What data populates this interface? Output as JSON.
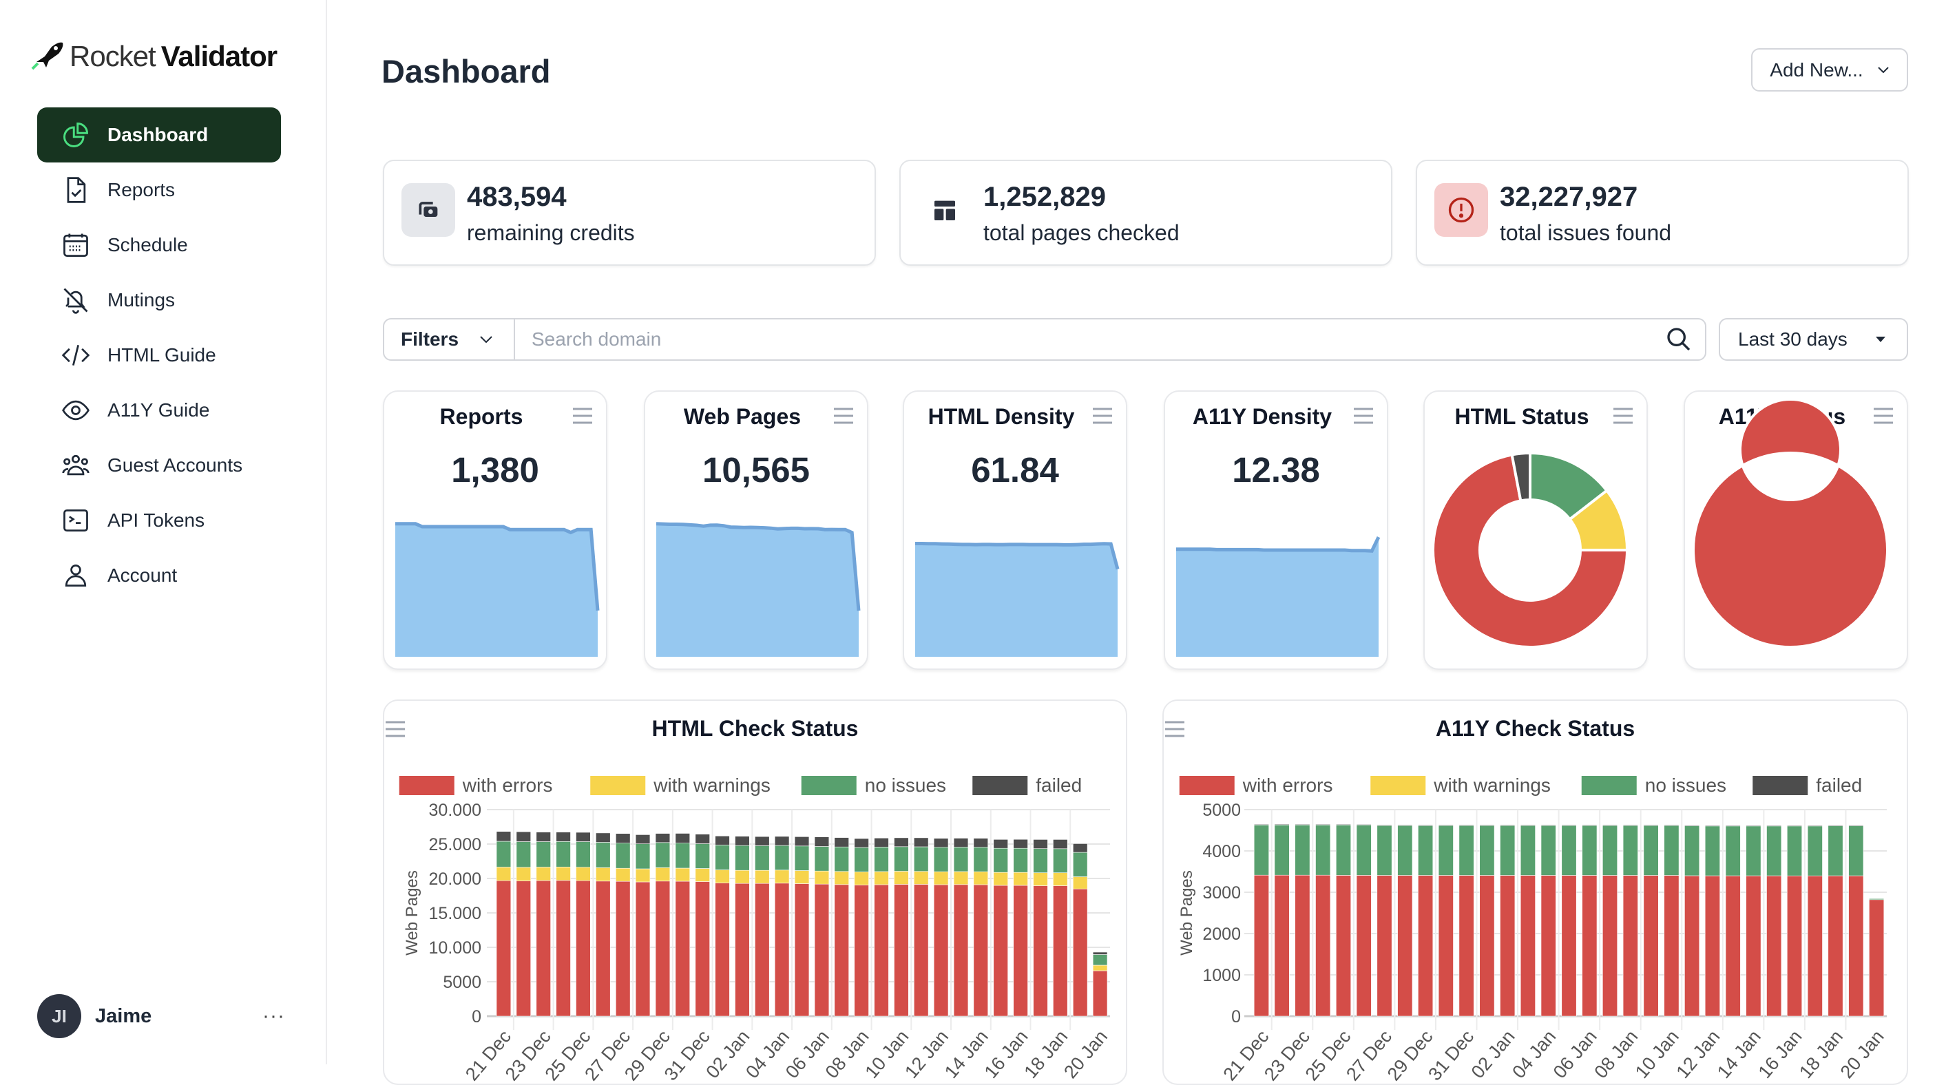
{
  "brand": {
    "name_light": "Rocket",
    "name_bold": "Validator"
  },
  "sidebar": {
    "items": [
      {
        "label": "Dashboard",
        "icon": "chart-pie-icon",
        "active": true
      },
      {
        "label": "Reports",
        "icon": "document-check-icon"
      },
      {
        "label": "Schedule",
        "icon": "calendar-icon"
      },
      {
        "label": "Mutings",
        "icon": "bell-slash-icon"
      },
      {
        "label": "HTML Guide",
        "icon": "code-icon"
      },
      {
        "label": "A11Y Guide",
        "icon": "eye-icon"
      },
      {
        "label": "Guest Accounts",
        "icon": "user-group-icon"
      },
      {
        "label": "API Tokens",
        "icon": "terminal-icon"
      },
      {
        "label": "Account",
        "icon": "user-icon"
      }
    ]
  },
  "user": {
    "initials": "JI",
    "name": "Jaime",
    "menu": "···"
  },
  "header": {
    "title": "Dashboard",
    "add_new": "Add New..."
  },
  "stats": [
    {
      "value": "483,594",
      "label": "remaining credits",
      "icon": "credits-icon"
    },
    {
      "value": "1,252,829",
      "label": "total pages checked",
      "icon": "layout-icon"
    },
    {
      "value": "32,227,927",
      "label": "total issues found",
      "icon": "exclamation-circle-icon"
    }
  ],
  "filters": {
    "label": "Filters",
    "search_placeholder": "Search domain",
    "search_value": "",
    "range": "Last 30 days"
  },
  "colors": {
    "errors": "#d44d48",
    "warnings": "#f7d44c",
    "no_issues": "#58a06e",
    "failed": "#4d4d4d",
    "spark_fill": "#96c8f0",
    "spark_line": "#6fa3d8",
    "nav_active": "#173420"
  },
  "chart_data": [
    {
      "type": "area",
      "title": "Reports",
      "value": "1,380",
      "ylim": [
        0,
        60
      ],
      "values": [
        46,
        46,
        46,
        46,
        45,
        45,
        45,
        45,
        45,
        45,
        45,
        45,
        45,
        45,
        45,
        45,
        45,
        44,
        44,
        44,
        44,
        44,
        44,
        44,
        44,
        44,
        43,
        44,
        44,
        44,
        16
      ]
    },
    {
      "type": "area",
      "title": "Web Pages",
      "value": "10,565",
      "ylim": [
        0,
        35000
      ],
      "values": [
        26830,
        26790,
        26730,
        26730,
        26700,
        26610,
        26530,
        26360,
        26540,
        26550,
        26430,
        26170,
        26130,
        26090,
        26110,
        26070,
        26030,
        25940,
        25800,
        25870,
        25910,
        25910,
        25830,
        25850,
        25840,
        25670,
        25680,
        25660,
        25660,
        25060,
        9300
      ]
    },
    {
      "type": "area",
      "title": "HTML Density",
      "value": "61.84",
      "ylim": [
        0,
        95
      ],
      "values": [
        62.0,
        62.0,
        61.9,
        61.9,
        61.8,
        61.7,
        61.6,
        61.5,
        61.5,
        61.4,
        61.5,
        61.5,
        61.4,
        61.4,
        61.5,
        61.5,
        61.5,
        61.4,
        61.4,
        61.4,
        61.4,
        61.4,
        61.3,
        61.3,
        61.4,
        61.6,
        61.6,
        61.8,
        61.9,
        61.8,
        48.0
      ]
    },
    {
      "type": "area",
      "title": "A11Y Density",
      "value": "12.38",
      "ylim": [
        0,
        20
      ],
      "values": [
        12.4,
        12.4,
        12.4,
        12.4,
        12.4,
        12.4,
        12.35,
        12.35,
        12.35,
        12.35,
        12.35,
        12.35,
        12.35,
        12.3,
        12.3,
        12.3,
        12.3,
        12.3,
        12.3,
        12.3,
        12.3,
        12.3,
        12.3,
        12.3,
        12.3,
        12.3,
        12.25,
        12.25,
        12.25,
        12.2,
        13.8
      ]
    },
    {
      "type": "pie",
      "title": "HTML Status",
      "donut": true,
      "slices": [
        {
          "key": "no_issues",
          "value": 14.5
        },
        {
          "key": "warnings",
          "value": 10.5
        },
        {
          "key": "errors",
          "value": 72
        },
        {
          "key": "failed",
          "value": 3
        }
      ]
    },
    {
      "type": "pie",
      "title": "A11Y Status",
      "donut": true,
      "slices": [
        {
          "key": "no_issues",
          "value": 0
        },
        {
          "key": "warnings",
          "value": 0
        },
        {
          "key": "errors",
          "value": 100
        },
        {
          "key": "failed",
          "value": 0
        }
      ]
    },
    {
      "type": "bar",
      "stacked": true,
      "title": "HTML Check Status",
      "ylabel": "Web Pages",
      "ylim": [
        0,
        30000
      ],
      "y_ticks": [
        "0",
        "5000",
        "10.000",
        "15.000",
        "20.000",
        "25.000",
        "30.000"
      ],
      "x_labels": [
        "21 Dec",
        "23 Dec",
        "25 Dec",
        "27 Dec",
        "29 Dec",
        "31 Dec",
        "02 Jan",
        "04 Jan",
        "06 Jan",
        "08 Jan",
        "10 Jan",
        "12 Jan",
        "14 Jan",
        "16 Jan",
        "18 Jan",
        "20 Jan"
      ],
      "legend": "top",
      "grid": true,
      "series": [
        {
          "name": "with errors",
          "key": "errors",
          "values": [
            19680,
            19650,
            19700,
            19720,
            19680,
            19620,
            19580,
            19500,
            19620,
            19600,
            19550,
            19350,
            19280,
            19280,
            19320,
            19250,
            19180,
            19120,
            19050,
            19100,
            19150,
            19150,
            19100,
            19120,
            19100,
            19000,
            19000,
            18950,
            18950,
            18480,
            6600
          ]
        },
        {
          "name": "with warnings",
          "key": "warnings",
          "values": [
            1970,
            1970,
            1950,
            1950,
            1950,
            1950,
            1900,
            1900,
            1950,
            1900,
            1900,
            1900,
            1900,
            1900,
            1900,
            1900,
            1900,
            1900,
            1900,
            1900,
            1900,
            1880,
            1880,
            1880,
            1880,
            1880,
            1880,
            1880,
            1880,
            1770,
            800
          ]
        },
        {
          "name": "no issues",
          "key": "no_issues",
          "values": [
            3750,
            3730,
            3700,
            3700,
            3720,
            3680,
            3650,
            3630,
            3650,
            3630,
            3600,
            3600,
            3600,
            3580,
            3570,
            3570,
            3570,
            3560,
            3550,
            3560,
            3570,
            3570,
            3550,
            3550,
            3560,
            3500,
            3500,
            3500,
            3490,
            3540,
            1550
          ]
        },
        {
          "name": "failed",
          "key": "failed",
          "values": [
            1430,
            1440,
            1380,
            1360,
            1350,
            1360,
            1400,
            1330,
            1320,
            1420,
            1380,
            1320,
            1350,
            1330,
            1320,
            1350,
            1380,
            1360,
            1300,
            1310,
            1290,
            1310,
            1300,
            1300,
            1300,
            1290,
            1300,
            1330,
            1340,
            1270,
            350
          ]
        }
      ]
    },
    {
      "type": "bar",
      "stacked": true,
      "title": "A11Y Check Status",
      "ylabel": "Web Pages",
      "ylim": [
        0,
        5000
      ],
      "y_ticks": [
        "0",
        "1000",
        "2000",
        "3000",
        "4000",
        "5000"
      ],
      "x_labels": [
        "21 Dec",
        "23 Dec",
        "25 Dec",
        "27 Dec",
        "29 Dec",
        "31 Dec",
        "02 Jan",
        "04 Jan",
        "06 Jan",
        "08 Jan",
        "10 Jan",
        "12 Jan",
        "14 Jan",
        "16 Jan",
        "18 Jan",
        "20 Jan"
      ],
      "legend": "top",
      "grid": true,
      "series": [
        {
          "name": "with errors",
          "key": "errors",
          "values": [
            3413,
            3413,
            3413,
            3413,
            3410,
            3410,
            3408,
            3408,
            3408,
            3408,
            3408,
            3408,
            3408,
            3408,
            3408,
            3408,
            3408,
            3408,
            3408,
            3408,
            3408,
            3400,
            3398,
            3398,
            3398,
            3398,
            3396,
            3396,
            3398,
            3398,
            2820
          ]
        },
        {
          "name": "with warnings",
          "key": "warnings",
          "values": [
            0,
            0,
            0,
            0,
            0,
            0,
            0,
            0,
            0,
            0,
            0,
            0,
            0,
            0,
            0,
            0,
            0,
            0,
            0,
            0,
            0,
            0,
            0,
            0,
            0,
            0,
            0,
            0,
            0,
            0,
            0
          ]
        },
        {
          "name": "no issues",
          "key": "no_issues",
          "values": [
            1218,
            1220,
            1218,
            1218,
            1222,
            1220,
            1212,
            1212,
            1210,
            1212,
            1212,
            1212,
            1212,
            1212,
            1212,
            1212,
            1212,
            1212,
            1212,
            1212,
            1212,
            1215,
            1212,
            1212,
            1212,
            1212,
            1215,
            1215,
            1218,
            1218,
            25
          ]
        },
        {
          "name": "failed",
          "key": "failed",
          "values": [
            12,
            12,
            12,
            12,
            12,
            12,
            10,
            10,
            10,
            10,
            10,
            10,
            10,
            10,
            10,
            10,
            10,
            10,
            10,
            10,
            10,
            8,
            8,
            8,
            8,
            8,
            8,
            8,
            8,
            8,
            0
          ]
        }
      ]
    }
  ]
}
